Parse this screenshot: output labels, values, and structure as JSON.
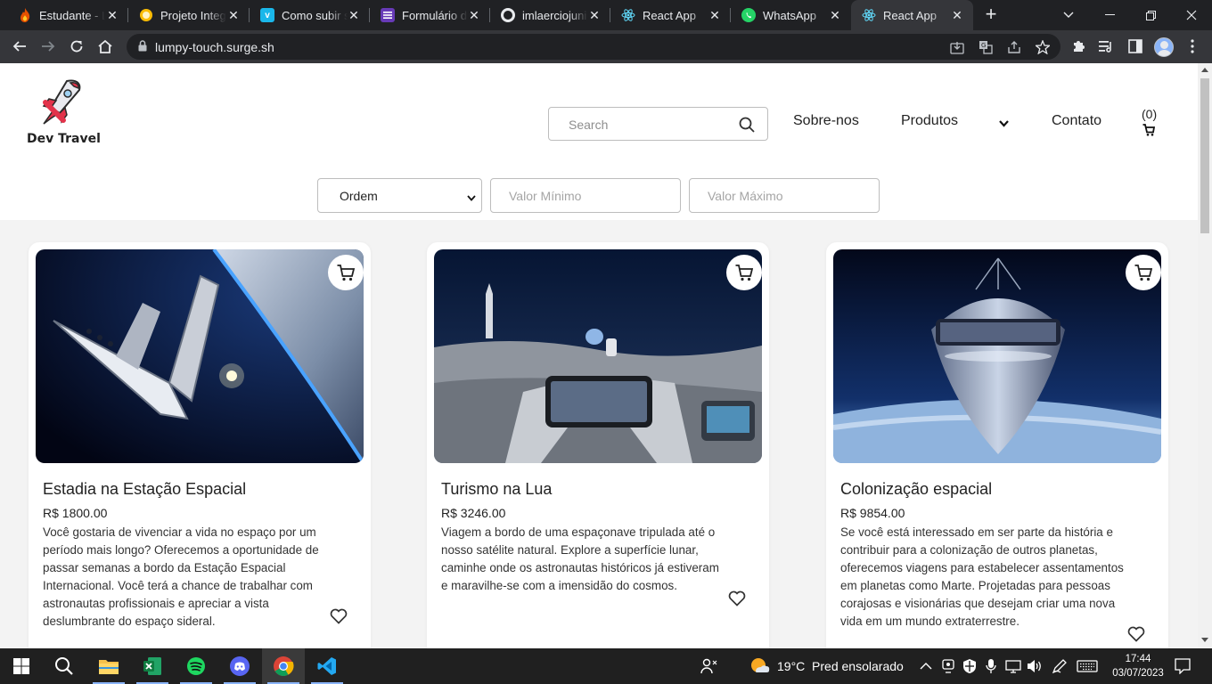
{
  "browser": {
    "tabs": [
      {
        "title": "Estudante - L",
        "favicon_color": "#e8eaed",
        "favicon_glyph": "fire-icon"
      },
      {
        "title": "Projeto Integ",
        "favicon_color": "#fbbc04",
        "favicon_glyph": "lemon-icon"
      },
      {
        "title": "Como subir s",
        "favicon_color": "#1ab7ea",
        "favicon_glyph": "vimeo-icon"
      },
      {
        "title": "Formulário d",
        "favicon_color": "#673ab7",
        "favicon_glyph": "forms-icon"
      },
      {
        "title": "imlaerciojuni",
        "favicon_color": "#e8eaed",
        "favicon_glyph": "github-icon"
      },
      {
        "title": "React App",
        "favicon_color": "#61dafb",
        "favicon_glyph": "react-icon"
      },
      {
        "title": "WhatsApp",
        "favicon_color": "#25d366",
        "favicon_glyph": "whatsapp-icon"
      },
      {
        "title": "React App",
        "favicon_color": "#61dafb",
        "favicon_glyph": "react-icon",
        "active": true
      }
    ],
    "url": "lumpy-touch.surge.sh"
  },
  "site": {
    "logo_text": "Dev Travel",
    "search_placeholder": "Search",
    "nav": {
      "about": "Sobre-nos",
      "products": "Produtos",
      "contact": "Contato",
      "cart_count": "(0)"
    },
    "filters": {
      "order_selected": "Ordem",
      "min_placeholder": "Valor Mínimo",
      "max_placeholder": "Valor Máximo"
    },
    "products": [
      {
        "title": "Estadia na Estação Espacial",
        "price": "R$ 1800.00",
        "description": "Você gostaria de vivenciar a vida no espaço por um período mais longo? Oferecemos a oportunidade de passar semanas a bordo da Estação Espacial Internacional. Você terá a chance de trabalhar com astronautas profissionais e apreciar a vista deslumbrante do espaço sideral."
      },
      {
        "title": "Turismo na Lua",
        "price": "R$ 3246.00",
        "description": "Viagem a bordo de uma espaçonave tripulada até o nosso satélite natural. Explore a superfície lunar, caminhe onde os astronautas históricos já estiveram e maravilhe-se com a imensidão do cosmos."
      },
      {
        "title": "Colonização espacial",
        "price": "R$ 9854.00",
        "description": "Se você está interessado em ser parte da história e contribuir para a colonização de outros planetas, oferecemos viagens para estabelecer assentamentos em planetas como Marte. Projetadas para pessoas corajosas e visionárias que desejam criar uma nova vida em um mundo extraterrestre."
      }
    ]
  },
  "taskbar": {
    "weather": "19°C  Pred ensolarado",
    "time": "17:44",
    "date": "03/07/2023",
    "apps": [
      "start-icon",
      "search-icon",
      "file-explorer-icon",
      "excel-icon",
      "spotify-icon",
      "discord-icon",
      "chrome-icon",
      "vscode-icon"
    ]
  }
}
